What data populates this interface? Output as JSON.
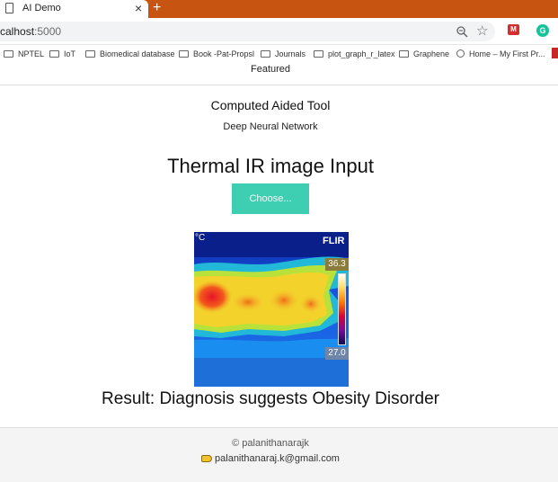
{
  "browser": {
    "tab_title": "AI Demo",
    "tab_close": "×",
    "new_tab": "+",
    "url_host": "calhost",
    "url_port": ":5000",
    "star": "☆",
    "ext_red": "M",
    "ext_green": "G",
    "bookmarks": [
      {
        "label": "NPTEL",
        "icon": "folder-icon"
      },
      {
        "label": "IoT",
        "icon": "folder-icon"
      },
      {
        "label": "Biomedical database",
        "icon": "folder-icon"
      },
      {
        "label": "Book -Pat-Propsl",
        "icon": "folder-icon"
      },
      {
        "label": "Journals",
        "icon": "folder-icon"
      },
      {
        "label": "plot_graph_r_latex",
        "icon": "folder-icon"
      },
      {
        "label": "Graphene",
        "icon": "folder-icon"
      },
      {
        "label": "Home – My First Pr...",
        "icon": "globe-icon"
      }
    ]
  },
  "nav": {
    "featured": "Featured"
  },
  "main": {
    "tool_title": "Computed Aided Tool",
    "tool_subtitle": "Deep Neural Network",
    "input_title": "Thermal IR image Input",
    "choose_button": "Choose...",
    "thermal": {
      "unit": "°C",
      "logo": "FLIR",
      "max": "36.3",
      "min": "27.0"
    },
    "result": "Result: Diagnosis suggests Obesity Disorder"
  },
  "footer": {
    "copyright": "© palanithanarajk",
    "email": "palanithanaraj.k@gmail.com"
  },
  "colors": {
    "tabstrip": "#c75511",
    "button": "#3ecfb3"
  }
}
